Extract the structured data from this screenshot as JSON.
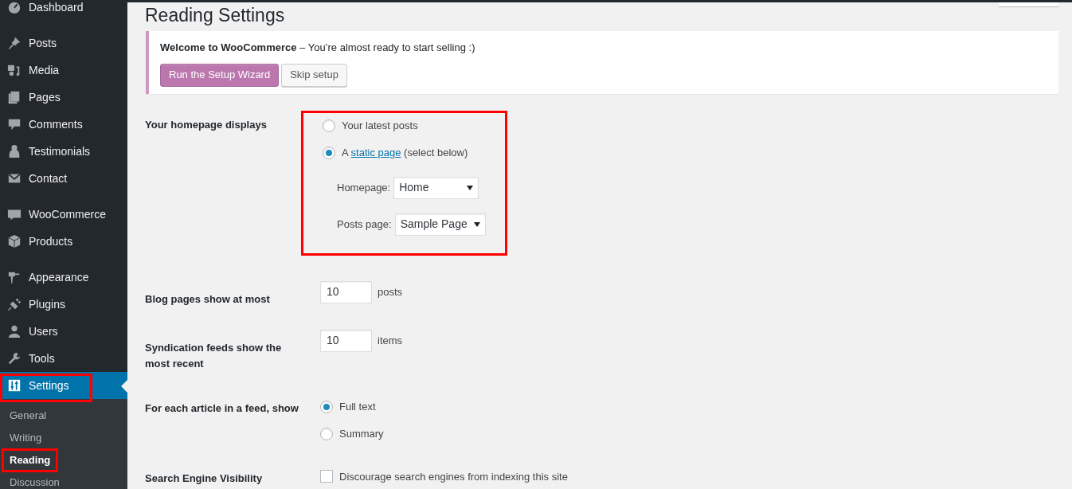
{
  "sidebar": {
    "groups": [
      [
        {
          "label": "Dashboard",
          "selected": false,
          "highlighted": false
        }
      ],
      [
        {
          "label": "Posts",
          "selected": false,
          "highlighted": false
        },
        {
          "label": "Media",
          "selected": false,
          "highlighted": false
        },
        {
          "label": "Pages",
          "selected": false,
          "highlighted": false
        },
        {
          "label": "Comments",
          "selected": false,
          "highlighted": false
        },
        {
          "label": "Testimonials",
          "selected": false,
          "highlighted": false
        },
        {
          "label": "Contact",
          "selected": false,
          "highlighted": false
        }
      ],
      [
        {
          "label": "WooCommerce",
          "selected": false,
          "highlighted": false
        },
        {
          "label": "Products",
          "selected": false,
          "highlighted": false
        }
      ],
      [
        {
          "label": "Appearance",
          "selected": false,
          "highlighted": false
        },
        {
          "label": "Plugins",
          "selected": false,
          "highlighted": false
        },
        {
          "label": "Users",
          "selected": false,
          "highlighted": false
        },
        {
          "label": "Tools",
          "selected": false,
          "highlighted": false
        },
        {
          "label": "Settings",
          "selected": true,
          "highlighted": true,
          "children": [
            {
              "label": "General",
              "selected": false,
              "highlighted": false
            },
            {
              "label": "Writing",
              "selected": false,
              "highlighted": false
            },
            {
              "label": "Reading",
              "selected": true,
              "highlighted": true
            },
            {
              "label": "Discussion",
              "selected": false,
              "highlighted": false
            }
          ]
        }
      ]
    ]
  },
  "page": {
    "title": "Reading Settings"
  },
  "notice": {
    "message": "**Welcome to WooCommerce** – You’re almost ready to start selling :)",
    "buttons": [
      {
        "label": "Run the Setup Wizard",
        "kind": "primary"
      },
      {
        "label": "Skip setup",
        "kind": "secondary"
      }
    ]
  },
  "settings": [
    {
      "kind": "radios",
      "label": "Your homepage displays",
      "highlighted": true,
      "options": [
        {
          "label": "Your latest posts",
          "selected": false
        },
        {
          "prefix": "A ",
          "link": "static page",
          "suffix": " (select below)",
          "selected": true
        }
      ],
      "selects": [
        {
          "label": "Homepage:",
          "value": "Home"
        },
        {
          "label": "Posts page:",
          "value": "Sample Page"
        }
      ]
    },
    {
      "kind": "number",
      "label": "Blog pages show at most",
      "value": "10",
      "unit": "posts"
    },
    {
      "kind": "number",
      "label": "Syndication feeds show the most recent",
      "value": "10",
      "unit": "items"
    },
    {
      "kind": "radios",
      "label": "For each article in a feed, show",
      "highlighted": false,
      "options": [
        {
          "label": "Full text",
          "selected": true
        },
        {
          "label": "Summary",
          "selected": false
        }
      ]
    },
    {
      "kind": "checkbox",
      "label": "Search Engine Visibility",
      "text": "Discourage search engines from indexing this site",
      "checked": false
    }
  ]
}
